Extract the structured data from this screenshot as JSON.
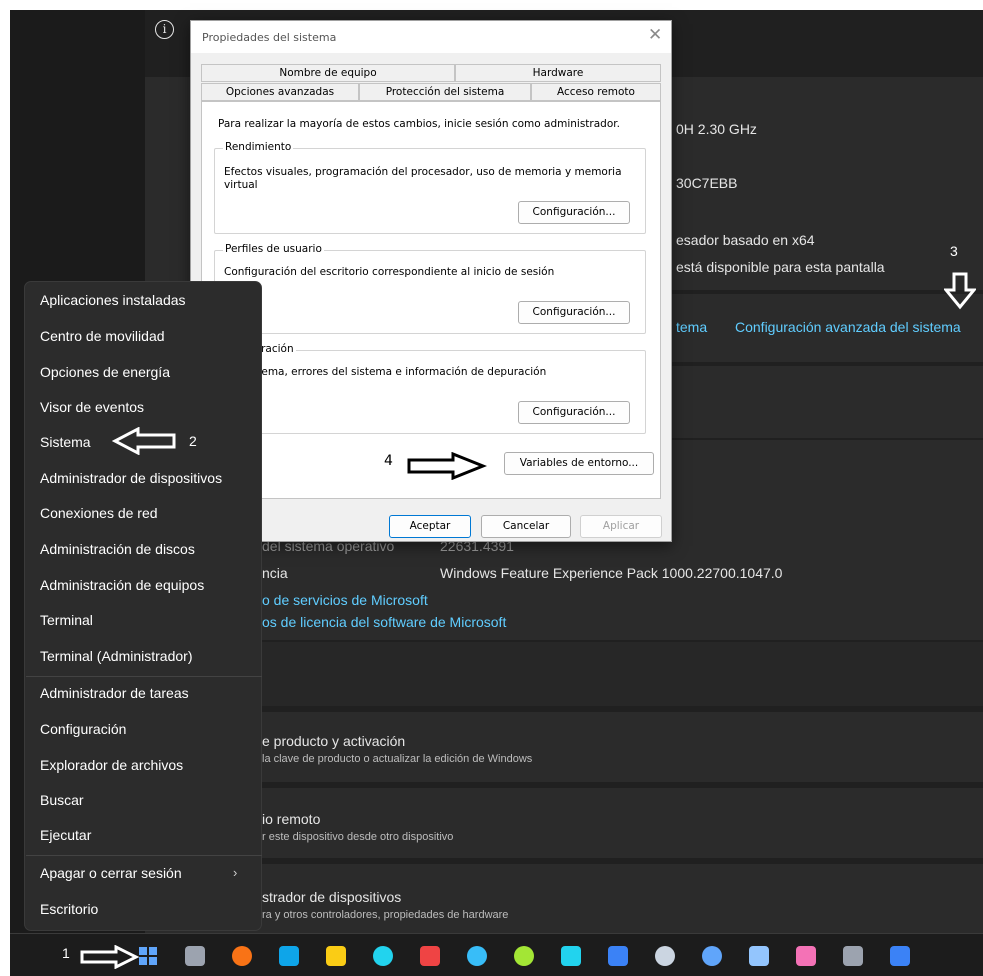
{
  "settings": {
    "processor_fragment": "0H  2.30 GHz",
    "device_id_fragment": "30C7EBB",
    "system_type_fragment": "esador basado en x64",
    "pen_touch_fragment": "está disponible para esta pantalla",
    "related_link_1": "tema",
    "related_link_2": "Configuración avanzada del sistema",
    "os_build_label": "del sistema operativo",
    "os_build_value": "22631.4391",
    "experience_label": "ncia",
    "experience_value": "Windows Feature Experience Pack 1000.22700.1047.0",
    "link_services": "o de servicios de Microsoft",
    "link_license": "os de licencia del software de Microsoft",
    "item1_title": "e producto y activación",
    "item1_sub": "la clave de producto o actualizar la edición de Windows",
    "item2_title": "io remoto",
    "item2_sub": "r este dispositivo desde otro dispositivo",
    "item3_title": "strador de dispositivos",
    "item3_sub": "ra y otros controladores, propiedades de hardware"
  },
  "context_menu": {
    "items": [
      "Aplicaciones instaladas",
      "Centro de movilidad",
      "Opciones de energía",
      "Visor de eventos",
      "Sistema",
      "Administrador de dispositivos",
      "Conexiones de red",
      "Administración de discos",
      "Administración de equipos",
      "Terminal",
      "Terminal (Administrador)",
      "Administrador de tareas",
      "Configuración",
      "Explorador de archivos",
      "Buscar",
      "Ejecutar",
      "Apagar o cerrar sesión",
      "Escritorio"
    ],
    "chevron": "›"
  },
  "dialog": {
    "title": "Propiedades del sistema",
    "close": "✕",
    "tabs_row1": [
      "Nombre de equipo",
      "Hardware"
    ],
    "tabs_row2": [
      "Opciones avanzadas",
      "Protección del sistema",
      "Acceso remoto"
    ],
    "admin_note": "Para realizar la mayoría de estos cambios, inicie sesión como administrador.",
    "performance": {
      "label": "Rendimiento",
      "desc_line1": "Efectos visuales, programación del procesador, uso de memoria y memoria",
      "desc_line2": "virtual",
      "button": "Configuración..."
    },
    "profiles": {
      "label": "Perfiles de usuario",
      "desc": "Configuración del escritorio correspondiente al inicio de sesión",
      "button": "Configuración..."
    },
    "recovery": {
      "label": "recuperación",
      "desc": "del sistema, errores del sistema e información de depuración",
      "button": "Configuración..."
    },
    "env_button": "Variables de entorno...",
    "ok": "Aceptar",
    "cancel": "Cancelar",
    "apply": "Aplicar"
  },
  "annotations": {
    "step1": "1",
    "step2": "2",
    "step3": "3",
    "step4": "4"
  },
  "taskbar": {
    "icons": [
      "start-icon",
      "task-view-icon",
      "firefox-icon",
      "outlook-icon",
      "file-explorer-icon",
      "edge-icon",
      "snip-icon",
      "telegram-icon",
      "app-icon",
      "package-icon",
      "word-icon",
      "steam-icon",
      "remote-icon",
      "notepad-icon",
      "winrar-icon",
      "settings-icon",
      "system-icon"
    ],
    "colors": [
      "#60a5fa",
      "#9ca3af",
      "#f97316",
      "#0ea5e9",
      "#facc15",
      "#22d3ee",
      "#ef4444",
      "#38bdf8",
      "#a3e635",
      "#22d3ee",
      "#3b82f6",
      "#cbd5e1",
      "#60a5fa",
      "#93c5fd",
      "#f472b6",
      "#9ca3af",
      "#3b82f6"
    ]
  }
}
